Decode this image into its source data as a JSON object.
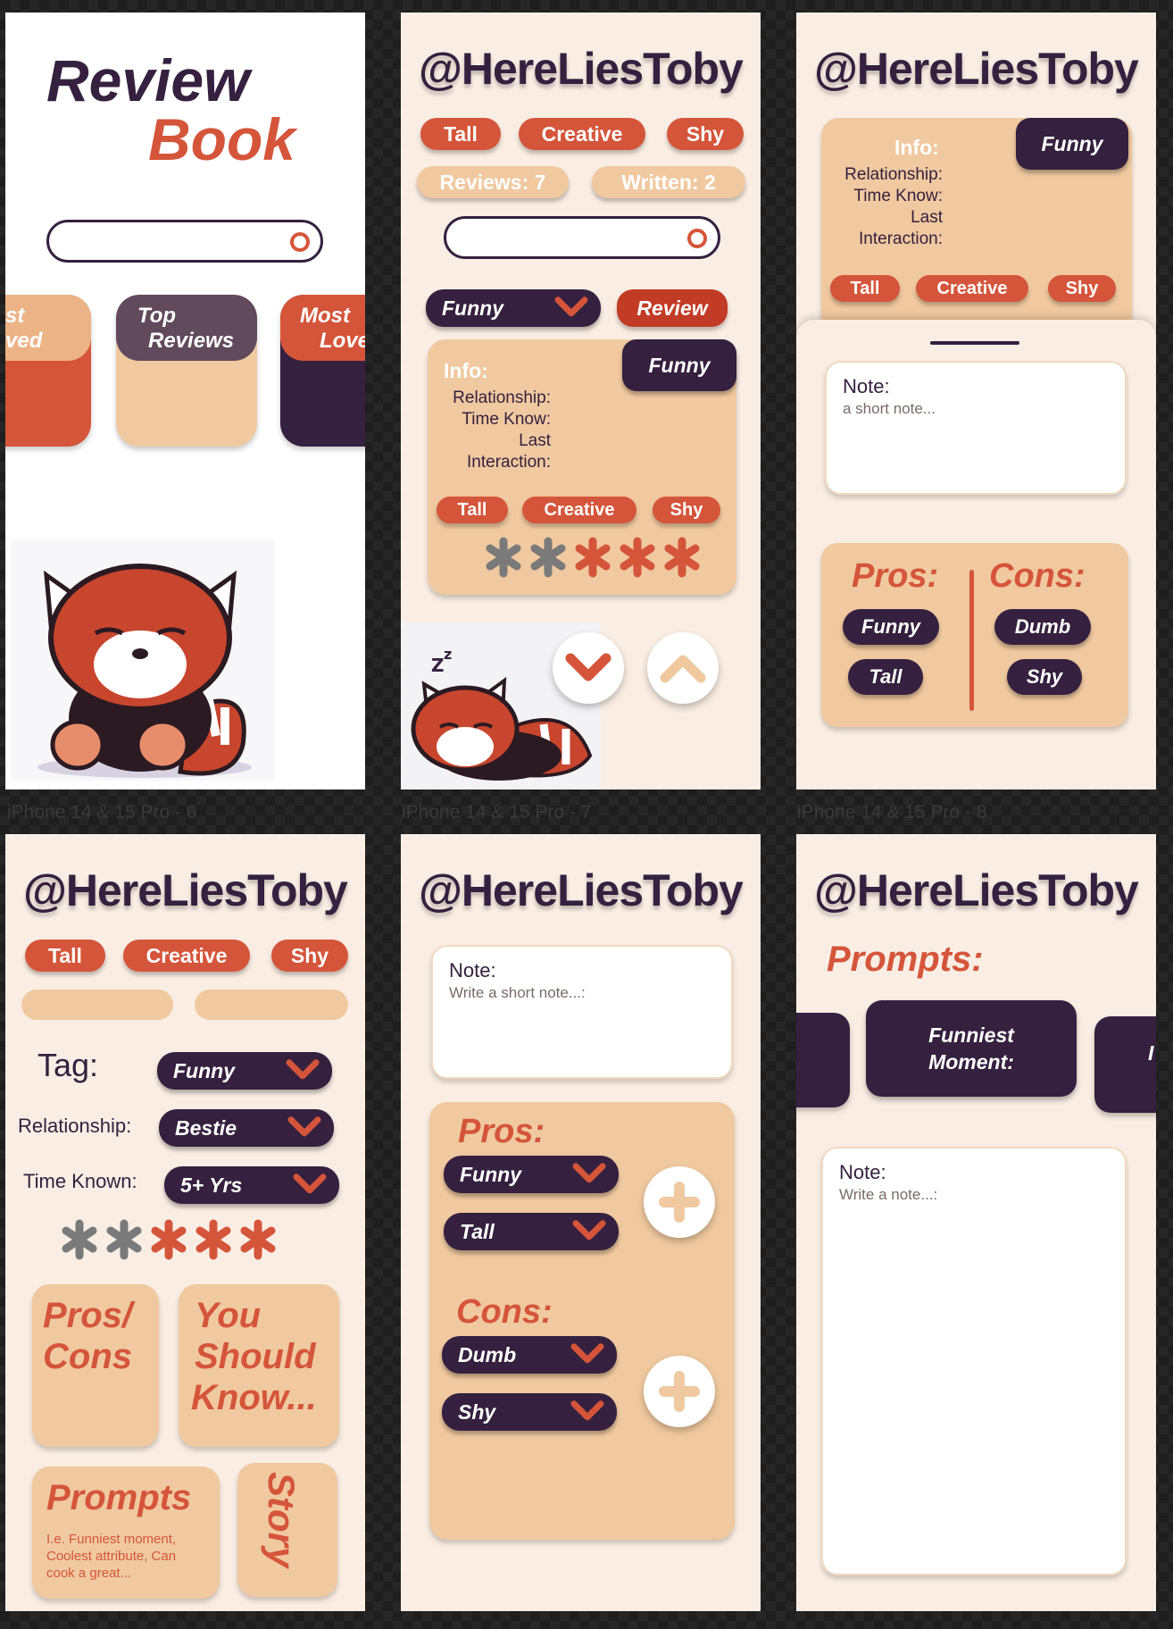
{
  "frame_labels": [
    "iPhone 14 & 15 Pro - 6",
    "iPhone 14 & 15 Pro - 7",
    "iPhone 14 & 15 Pro - 8"
  ],
  "home": {
    "title_line1": "Review",
    "title_line2": "Book",
    "categories": [
      {
        "line1": "st",
        "line2": "ved"
      },
      {
        "line1": "Top",
        "line2": "Reviews"
      },
      {
        "line1": "Most",
        "line2": "Love"
      }
    ]
  },
  "profile": {
    "handle": "@HereLiesToby",
    "traits": [
      "Tall",
      "Creative",
      "Shy"
    ],
    "reviews_label": "Reviews: 7",
    "written_label": "Written: 2",
    "tag_value": "Funny",
    "review_button": "Review",
    "info_title": "Info:",
    "info_tag": "Funny",
    "info_lines": [
      "Relationship:",
      "Time Know:",
      "Last",
      "Interaction:"
    ],
    "rating": {
      "value": 3,
      "max": 5
    },
    "colors": {
      "accent": "#d5553a",
      "plum": "#35203f",
      "peach": "#f0c9a0",
      "cream": "#faeee4"
    }
  },
  "detail_sheet": {
    "note_label": "Note:",
    "note_placeholder": "a short note...",
    "pros_title": "Pros:",
    "cons_title": "Cons:",
    "pros": [
      "Funny",
      "Tall"
    ],
    "cons": [
      "Dumb",
      "Shy"
    ]
  },
  "write_review": {
    "tag_label": "Tag:",
    "tag_value": "Funny",
    "relationship_label": "Relationship:",
    "relationship_value": "Bestie",
    "time_label": "Time Known:",
    "time_value": "5+ Yrs",
    "rating": {
      "value": 3,
      "max": 5
    },
    "tiles": {
      "proscons_1": "Pros/",
      "proscons_2": "Cons",
      "ysk_1": "You",
      "ysk_2": "Should",
      "ysk_3": "Know...",
      "prompts_title": "Prompts",
      "prompts_hint": "I.e. Funniest moment, Coolest attribute, Can cook a great...",
      "story": "Story"
    }
  },
  "pros_cons_editor": {
    "note_label": "Note:",
    "note_placeholder": "Write a short note...:",
    "pros_title": "Pros:",
    "cons_title": "Cons:",
    "pros": [
      "Funny",
      "Tall"
    ],
    "cons": [
      "Dumb",
      "Shy"
    ]
  },
  "prompts_screen": {
    "title": "Prompts:",
    "card_line1": "Funniest",
    "card_line2": "Moment:",
    "right_card_glimpse": "I",
    "note_label": "Note:",
    "note_placeholder": "Write a note...:"
  }
}
